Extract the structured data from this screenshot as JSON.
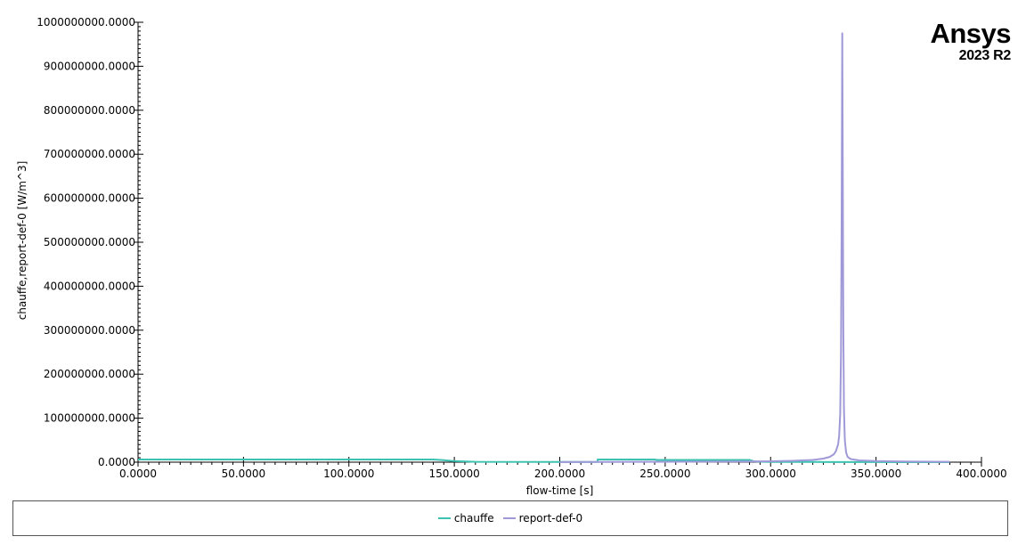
{
  "logo": {
    "name": "Ansys",
    "version": "2023 R2"
  },
  "chart_data": {
    "type": "line",
    "xlabel": "flow-time [s]",
    "ylabel": "chauffe,report-def-0 [W/m^3]",
    "xlim": [
      0,
      400
    ],
    "ylim": [
      0,
      1000000000
    ],
    "x_ticks": [
      0,
      50,
      100,
      150,
      200,
      250,
      300,
      350,
      400
    ],
    "x_tick_labels": [
      "0.0000",
      "50.0000",
      "100.0000",
      "150.0000",
      "200.0000",
      "250.0000",
      "300.0000",
      "350.0000",
      "400.0000"
    ],
    "y_ticks": [
      0,
      100000000,
      200000000,
      300000000,
      400000000,
      500000000,
      600000000,
      700000000,
      800000000,
      900000000,
      1000000000
    ],
    "y_tick_labels": [
      "0.0000",
      "100000000.0000",
      "200000000.0000",
      "300000000.0000",
      "400000000.0000",
      "500000000.0000",
      "600000000.0000",
      "700000000.0000",
      "800000000.0000",
      "900000000.0000",
      "1000000000.0000"
    ],
    "grid": false,
    "legend_position": "bottom",
    "series": [
      {
        "name": "chauffe",
        "color": "#3cc2b0",
        "x": [
          0,
          140,
          145,
          150,
          160,
          200,
          217.9,
          218,
          245,
          246,
          270,
          290,
          292,
          295,
          300,
          320,
          330,
          334,
          335,
          336,
          340,
          350,
          370,
          385
        ],
        "y": [
          6000000,
          6000000,
          4500000,
          2500000,
          800000,
          500000,
          500000,
          6000000,
          6000000,
          5000000,
          5000000,
          5000000,
          2000000,
          1000000,
          600000,
          400000,
          300000,
          200000,
          200000,
          200000,
          200000,
          150000,
          100000,
          100000
        ]
      },
      {
        "name": "report-def-0",
        "color": "#9f99d8",
        "x": [
          200,
          260,
          290,
          300,
          310,
          320,
          325,
          328,
          330,
          331,
          332,
          332.5,
          333,
          333.4,
          333.7,
          334,
          334.2,
          334.5,
          334.8,
          335.2,
          335.8,
          336.5,
          338,
          342,
          350,
          360,
          370,
          385
        ],
        "y": [
          300000,
          1000000,
          1500000,
          2000000,
          3000000,
          5000000,
          8000000,
          12000000,
          18000000,
          25000000,
          40000000,
          60000000,
          110000000,
          250000000,
          550000000,
          975000000,
          700000000,
          300000000,
          120000000,
          50000000,
          22000000,
          12000000,
          7000000,
          4000000,
          2500000,
          1800000,
          1200000,
          900000
        ]
      }
    ]
  }
}
